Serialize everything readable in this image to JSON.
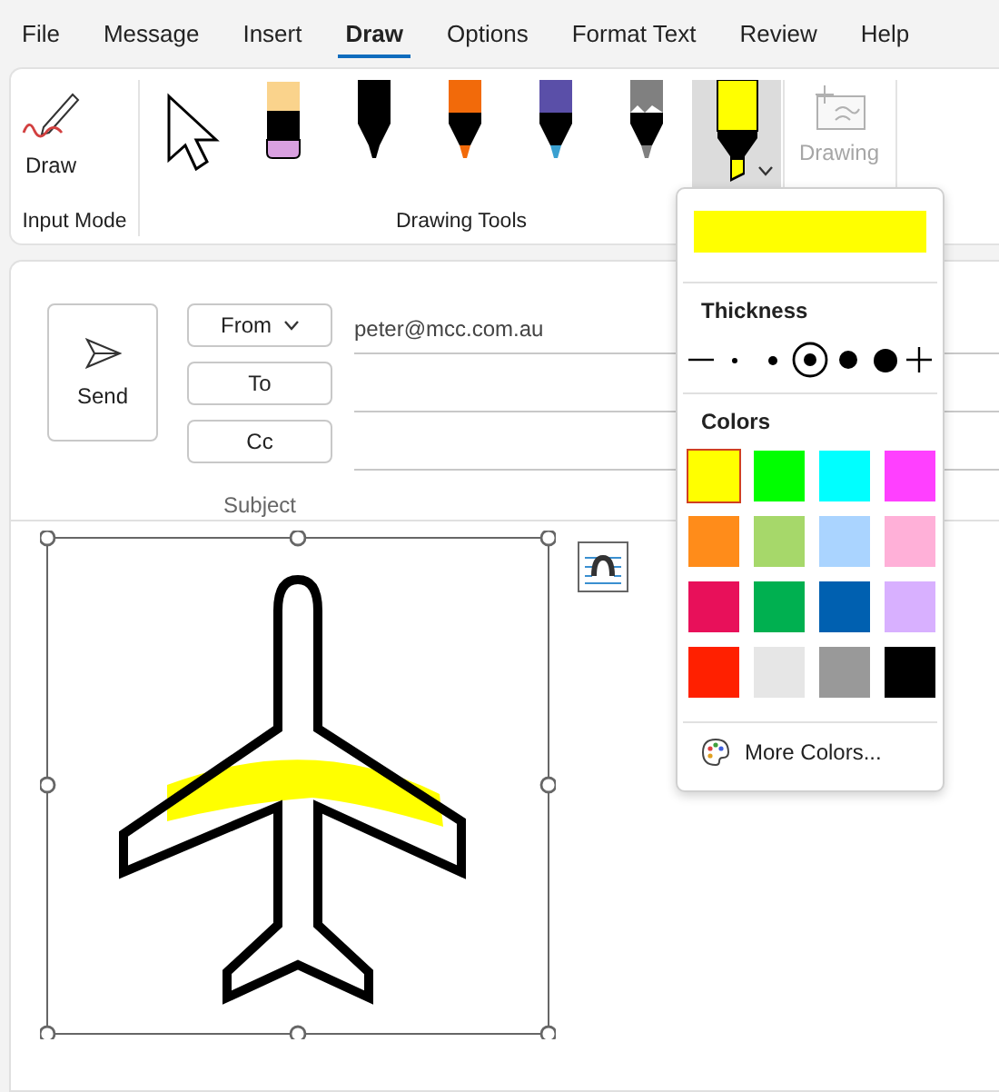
{
  "menu_tabs": [
    {
      "label": "File",
      "selected": false
    },
    {
      "label": "Message",
      "selected": false
    },
    {
      "label": "Insert",
      "selected": false
    },
    {
      "label": "Draw",
      "selected": true
    },
    {
      "label": "Options",
      "selected": false
    },
    {
      "label": "Format Text",
      "selected": false
    },
    {
      "label": "Review",
      "selected": false
    },
    {
      "label": "Help",
      "selected": false
    }
  ],
  "ribbon": {
    "input_mode": {
      "button": "Draw",
      "group_label": "Input Mode"
    },
    "drawing_tools": {
      "group_label": "Drawing Tools",
      "tools": [
        {
          "kind": "select",
          "selected": false
        },
        {
          "kind": "eraser",
          "selected": false
        },
        {
          "kind": "pen",
          "color": "#000000",
          "selected": false
        },
        {
          "kind": "pen",
          "color": "#f26a0a",
          "selected": false
        },
        {
          "kind": "galaxy",
          "color": "#5a4fa8",
          "selected": false
        },
        {
          "kind": "pencil",
          "color": "#808080",
          "selected": false
        },
        {
          "kind": "highlighter",
          "color": "#ffff00",
          "selected": true
        }
      ]
    },
    "drawing_canvas": {
      "label": "Drawing",
      "disabled": true
    }
  },
  "pen_menu": {
    "thickness_title": "Thickness",
    "thickness": [
      {
        "selected": false
      },
      {
        "selected": false
      },
      {
        "selected": true
      },
      {
        "selected": false
      },
      {
        "selected": false
      }
    ],
    "colors_title": "Colors",
    "colors": [
      {
        "color": "#ffff00",
        "selected": true
      },
      {
        "color": "#00ff00",
        "selected": false
      },
      {
        "color": "#00ffff",
        "selected": false
      },
      {
        "color": "#ff40ff",
        "selected": false
      },
      {
        "color": "#ff8c1a",
        "selected": false
      },
      {
        "color": "#a6d86a",
        "selected": false
      },
      {
        "color": "#aad4ff",
        "selected": false
      },
      {
        "color": "#ffb0d8",
        "selected": false
      },
      {
        "color": "#e8105a",
        "selected": false
      },
      {
        "color": "#00b050",
        "selected": false
      },
      {
        "color": "#0060b0",
        "selected": false
      },
      {
        "color": "#d8b0ff",
        "selected": false
      },
      {
        "color": "#ff2000",
        "selected": false
      },
      {
        "color": "#e6e6e6",
        "selected": false
      },
      {
        "color": "#999999",
        "selected": false
      },
      {
        "color": "#000000",
        "selected": false
      }
    ],
    "more_colors": "More Colors..."
  },
  "compose": {
    "send": "Send",
    "from_button": "From",
    "from_value": "peter@mcc.com.au",
    "to_button": "To",
    "cc_button": "Cc",
    "subject_label": "Subject"
  }
}
